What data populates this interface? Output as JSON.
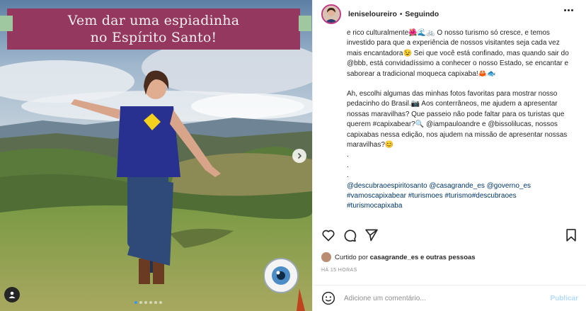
{
  "post": {
    "banner": {
      "line1": "Vem dar uma espiadinha",
      "line2": "no Espírito Santo!"
    },
    "carousel": {
      "slide_count": 6,
      "active_slide": 1
    }
  },
  "header": {
    "username": "leniseloureiro",
    "separator": "•",
    "follow_status": "Seguindo"
  },
  "caption": {
    "paragraph1": "e rico culturalmente🌺🌊🚲 O nosso turismo só cresce, e temos investido para que a experiência de nossos visitantes seja cada vez mais encantadora😉 Sei que você está confinado, mas quando sair do @bbb, está convidadíssimo a conhecer o nosso Estado, se encantar e saborear a tradicional moqueca capixaba!🦀🐟",
    "paragraph2": "Ah, escolhi algumas das minhas fotos favoritas para mostrar nosso pedacinho do Brasil.📷 Aos conterrâneos, me ajudem a apresentar nossas maravilhas? Que passeio não pode faltar para os turistas que querem #capixabear?🔍 @iampauloandre e @bissolilucas, nossos capixabas nessa edição, nos ajudem na missão de apresentar nossas maravilhas?😊",
    "dot1": ".",
    "dot2": ".",
    "dot3": ".",
    "tags": "@descubraoespiritosanto @casagrande_es @governo_es #vamoscapixabear #turismoes #turismo#descubraoes #turismocapixaba"
  },
  "likes": {
    "prefix": "Curtido por",
    "user": "casagrande_es",
    "suffix": "e outras pessoas"
  },
  "timestamp": "HÁ 15 HORAS",
  "comment": {
    "placeholder": "Adicione um comentário...",
    "publish_label": "Publicar"
  },
  "colors": {
    "banner_bg": "#95385f",
    "banner_tab": "#9fc7a0",
    "tag_link": "#00376b",
    "publish_disabled": "#b3dbff"
  },
  "icons": [
    "next-arrow-icon",
    "user-tag-icon",
    "more-options-icon",
    "heart-icon",
    "comment-icon",
    "share-icon",
    "bookmark-icon",
    "emoji-icon",
    "eye-logo-icon"
  ]
}
